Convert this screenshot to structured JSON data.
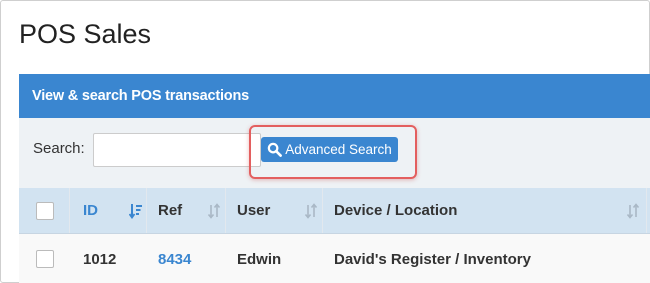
{
  "page": {
    "title": "POS Sales"
  },
  "panel": {
    "title": "View & search POS transactions"
  },
  "search": {
    "label": "Search:",
    "value": "",
    "placeholder": "",
    "advanced_button_label": "Advanced Search",
    "advanced_button_icon": "search-icon"
  },
  "table": {
    "columns": [
      {
        "label": "ID",
        "sort": "sorted-descending",
        "sort_icon": "sort-amount-down-icon"
      },
      {
        "label": "Ref",
        "sort": "sortable",
        "sort_icon": "sort-icon"
      },
      {
        "label": "User",
        "sort": "sortable",
        "sort_icon": "sort-icon"
      },
      {
        "label": "Device / Location",
        "sort": "sortable",
        "sort_icon": "sort-icon"
      }
    ],
    "rows": [
      {
        "id": "1012",
        "ref": "8434",
        "user": "Edwin",
        "device_location": "David's Register / Inventory",
        "checked": false
      }
    ]
  },
  "colors": {
    "accent": "#3a86d0",
    "header_bar": "#3a86d0",
    "table_header": "#d2e3f1",
    "highlight": "#e35f5f"
  }
}
